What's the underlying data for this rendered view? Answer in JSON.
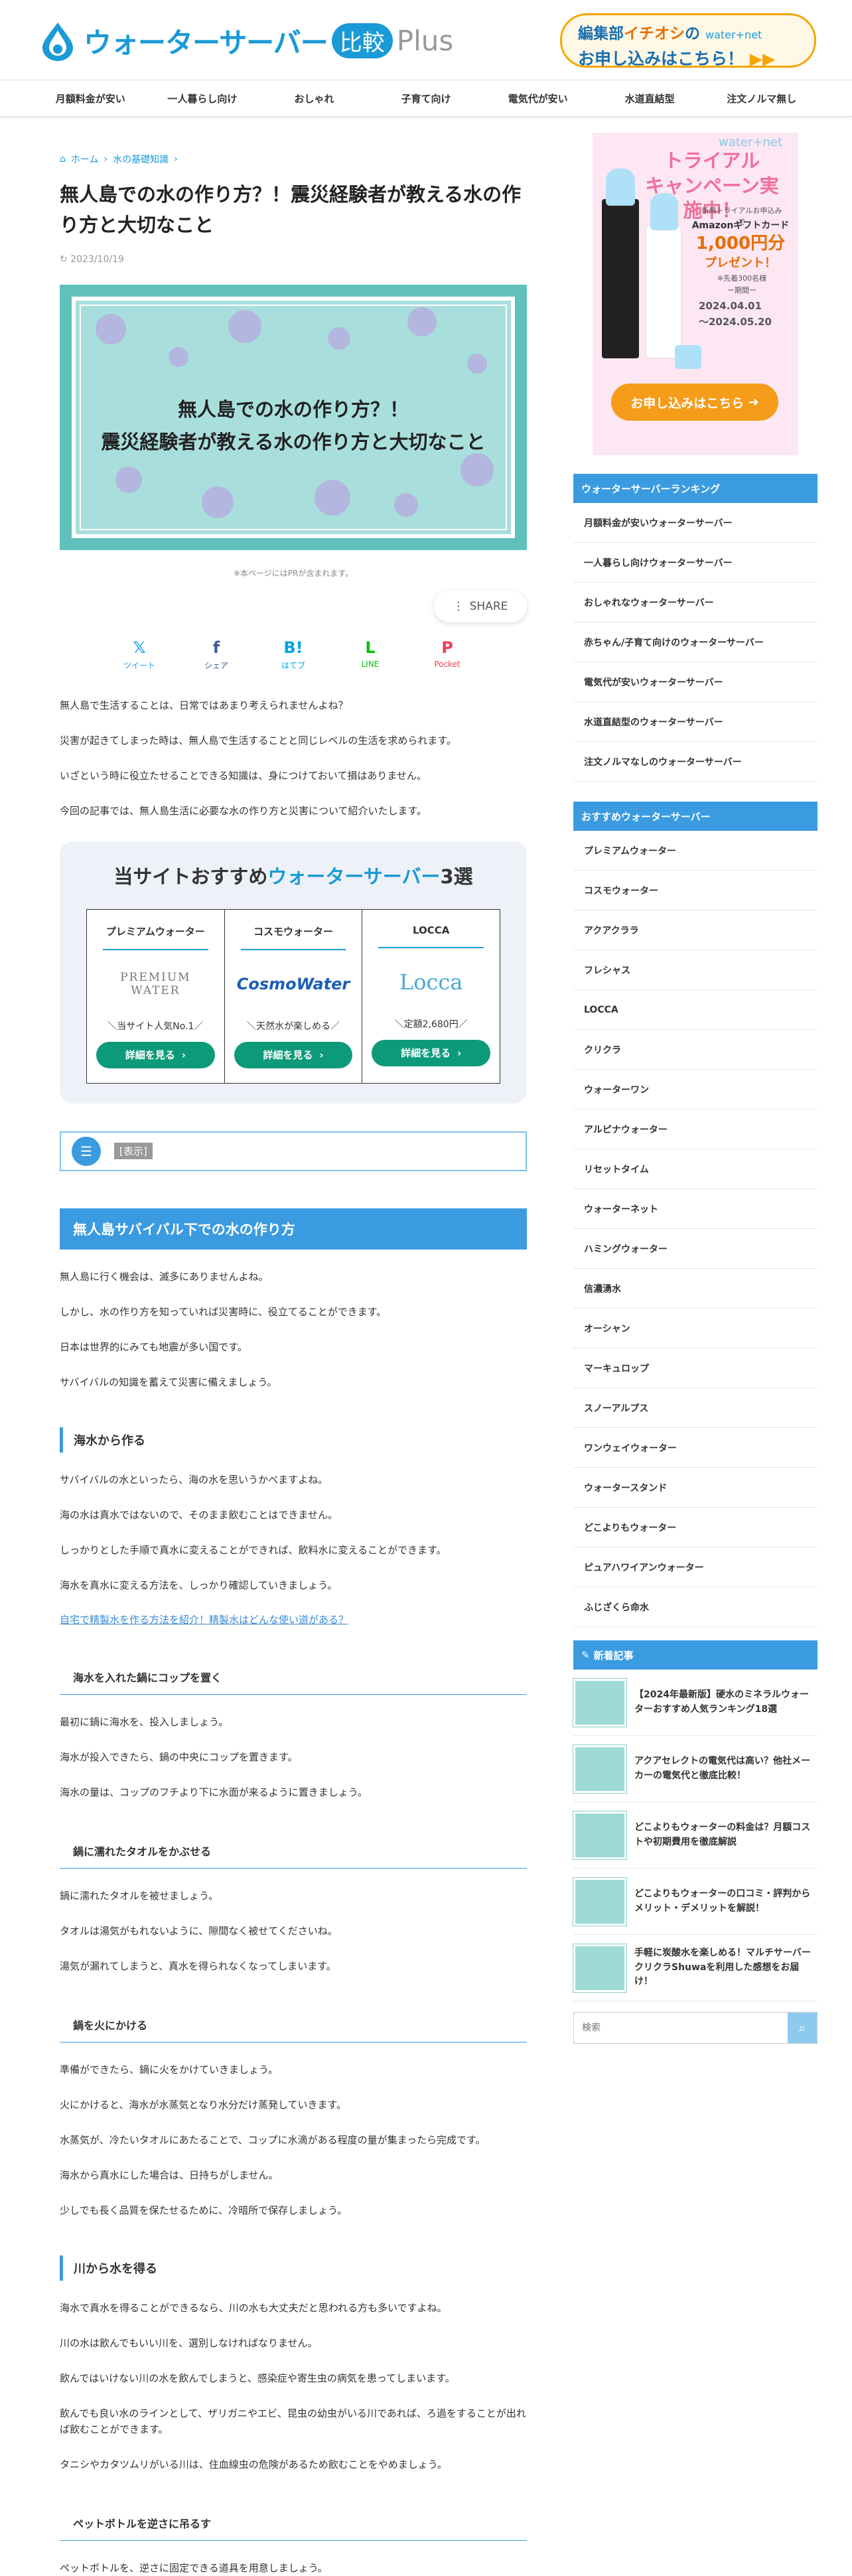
{
  "header": {
    "logo_text": "ウォーターサーバー",
    "logo_badge": "比較",
    "logo_plus": "Plus",
    "banner_line1_a": "編集部",
    "banner_line1_b": "イチオシ",
    "banner_line1_c": "の",
    "banner_brand": "water+net",
    "banner_line2": "お申し込みはこちら！",
    "banner_arrows": "▶▶"
  },
  "nav": [
    "月額料金が安い",
    "一人暮らし向け",
    "おしゃれ",
    "子育て向け",
    "電気代が安い",
    "水道直結型",
    "注文ノルマ無し"
  ],
  "breadcrumb": {
    "home": "ホーム",
    "category": "水の基礎知識"
  },
  "article": {
    "title": "無人島での水の作り方？！震災経験者が教える水の作り方と大切なこと",
    "date": "2023/10/19",
    "eyecatch_line1": "無人島での水の作り方？！",
    "eyecatch_line2": "震災経験者が教える水の作り方と大切なこと",
    "pr_note": "※本ページにはPRが含まれます。",
    "share": "SHARE",
    "sns": [
      {
        "label": "ツイート",
        "icon": "𝕏",
        "color": "#1da1f2"
      },
      {
        "label": "シェア",
        "icon": "f",
        "color": "#3b5998"
      },
      {
        "label": "はてブ",
        "icon": "B!",
        "color": "#00a4de"
      },
      {
        "label": "LINE",
        "icon": "L",
        "color": "#00c300"
      },
      {
        "label": "Pocket",
        "icon": "P",
        "color": "#ef4056"
      }
    ],
    "intro": [
      "無人島で生活することは、日常ではあまり考えられませんよね？",
      "災害が起きてしまった時は、無人島で生活することと同じレベルの生活を求められます。",
      "いざという時に役立たせることできる知識は、身につけておいて損はありません。",
      "今回の記事では、無人島生活に必要な水の作り方と災害について紹介いたします。"
    ]
  },
  "reco": {
    "title_a": "当サイトおすすめ",
    "title_b": "ウォーターサーバー",
    "title_c": "3選",
    "items": [
      {
        "name": "プレミアムウォーター",
        "logo": "PREMIUM WATER",
        "sub": "＼当サイト人気No.1／",
        "btn": "詳細を見る"
      },
      {
        "name": "コスモウォーター",
        "logo": "CosmoWater",
        "sub": "＼天然水が楽しめる／",
        "btn": "詳細を見る"
      },
      {
        "name": "LOCCA",
        "logo": "Locca",
        "sub": "＼定額2,680円／",
        "btn": "詳細を見る"
      }
    ]
  },
  "toc": {
    "label": "[表示]"
  },
  "sections": {
    "h2_1": "無人島サバイバル下での水の作り方",
    "h2_1_p": [
      "無人島に行く機会は、滅多にありませんよね。",
      "しかし、水の作り方を知っていれば災害時に、役立てることができます。",
      "日本は世界的にみても地震が多い国です。",
      "サバイバルの知識を蓄えて災害に備えましょう。"
    ],
    "h3_1": "海水から作る",
    "h3_1_p": [
      "サバイバルの水といったら、海の水を思いうかべますよね。",
      "海の水は真水ではないので、そのまま飲むことはできません。",
      "しっかりとした手順で真水に変えることができれば、飲料水に変えることができます。",
      "海水を真水に変える方法を、しっかり確認していきましょう。"
    ],
    "link_1": "自宅で精製水を作る方法を紹介！精製水はどんな使い道がある？",
    "h4_1": "海水を入れた鍋にコップを置く",
    "h4_1_p": [
      "最初に鍋に海水を、投入しましょう。",
      "海水が投入できたら、鍋の中央にコップを置きます。",
      "海水の量は、コップのフチより下に水面が来るように置きましょう。"
    ],
    "h4_2": "鍋に濡れたタオルをかぶせる",
    "h4_2_p": [
      "鍋に濡れたタオルを被せましょう。",
      "タオルは湯気がもれないように、隙間なく被せてくださいね。",
      "湯気が漏れてしまうと、真水を得られなくなってしまいます。"
    ],
    "h4_3": "鍋を火にかける",
    "h4_3_p": [
      "準備ができたら、鍋に火をかけていきましょう。",
      "火にかけると、海水が水蒸気となり水分だけ蒸発していきます。",
      "水蒸気が、冷たいタオルにあたることで、コップに水滴がある程度の量が集まったら完成です。",
      "海水から真水にした場合は、日持ちがしません。",
      "少しでも長く品質を保たせるために、冷暗所で保存しましょう。"
    ],
    "h3_2": "川から水を得る",
    "h3_2_p": [
      "海水で真水を得ることができるなら、川の水も大丈夫だと思われる方も多いですよね。",
      "川の水は飲んでもいい川を、選別しなければなりません。",
      "飲んではいけない川の水を飲んでしまうと、感染症や寄生虫の病気を患ってしまいます。",
      "飲んでも良い水のラインとして、ザリガニやエビ、昆虫の幼虫がいる川であれば、ろ過をすることが出れば飲むことができます。",
      "タニシやカタツムリがいる川は、住血線虫の危険があるため飲むことをやめましょう。"
    ],
    "h4_4": "ペットボトルを逆さに吊るす",
    "h4_4_p": [
      "ペットボトルを、逆さに固定できる道具を用意しましょう。"
    ]
  },
  "sidebar": {
    "banner": {
      "brand": "water+net",
      "title_1": "トライアル",
      "title_2": "キャンペーン実施中！",
      "sub": "新規トライアルお申込みで",
      "gift_1": "Amazonギフトカード",
      "gift_2": "1,000円分",
      "gift_3": "プレゼント！",
      "gift_note": "※先着300名様",
      "period_label": "ー期間ー",
      "date_1": "2024.04.01",
      "date_2": "〜2024.05.20",
      "btn": "お申し込みはこちら"
    },
    "ranking_title": "ウォーターサーバーランキング",
    "ranking": [
      "月額料金が安いウォーターサーバー",
      "一人暮らし向けウォーターサーバー",
      "おしゃれなウォーターサーバー",
      "赤ちゃん/子育て向けのウォーターサーバー",
      "電気代が安いウォーターサーバー",
      "水道直結型のウォーターサーバー",
      "注文ノルマなしのウォーターサーバー"
    ],
    "recommend_title": "おすすめウォーターサーバー",
    "recommend": [
      "プレミアムウォーター",
      "コスモウォーター",
      "アクアクララ",
      "フレシャス",
      "LOCCA",
      "クリクラ",
      "ウォーターワン",
      "アルピナウォーター",
      "リセットタイム",
      "ウォーターネット",
      "ハミングウォーター",
      "信濃湧水",
      "オーシャン",
      "マーキュロップ",
      "スノーアルプス",
      "ワンウェイウォーター",
      "ウォータースタンド",
      "どこよりもウォーター",
      "ピュアハワイアンウォーター",
      "ふじざくら命水"
    ],
    "new_title": "新着記事",
    "new_posts": [
      "【2024年最新版】硬水のミネラルウォーターおすすめ人気ランキング18選",
      "アクアセレクトの電気代は高い？他社メーカーの電気代と徹底比較！",
      "どこよりもウォーターの料金は？月額コストや初期費用を徹底解説",
      "どこよりもウォーターの口コミ・評判からメリット・デメリットを解説！",
      "手軽に炭酸水を楽しめる！マルチサーバー クリクラShuwaを利用した感想をお届け！"
    ],
    "search_placeholder": "検索"
  }
}
